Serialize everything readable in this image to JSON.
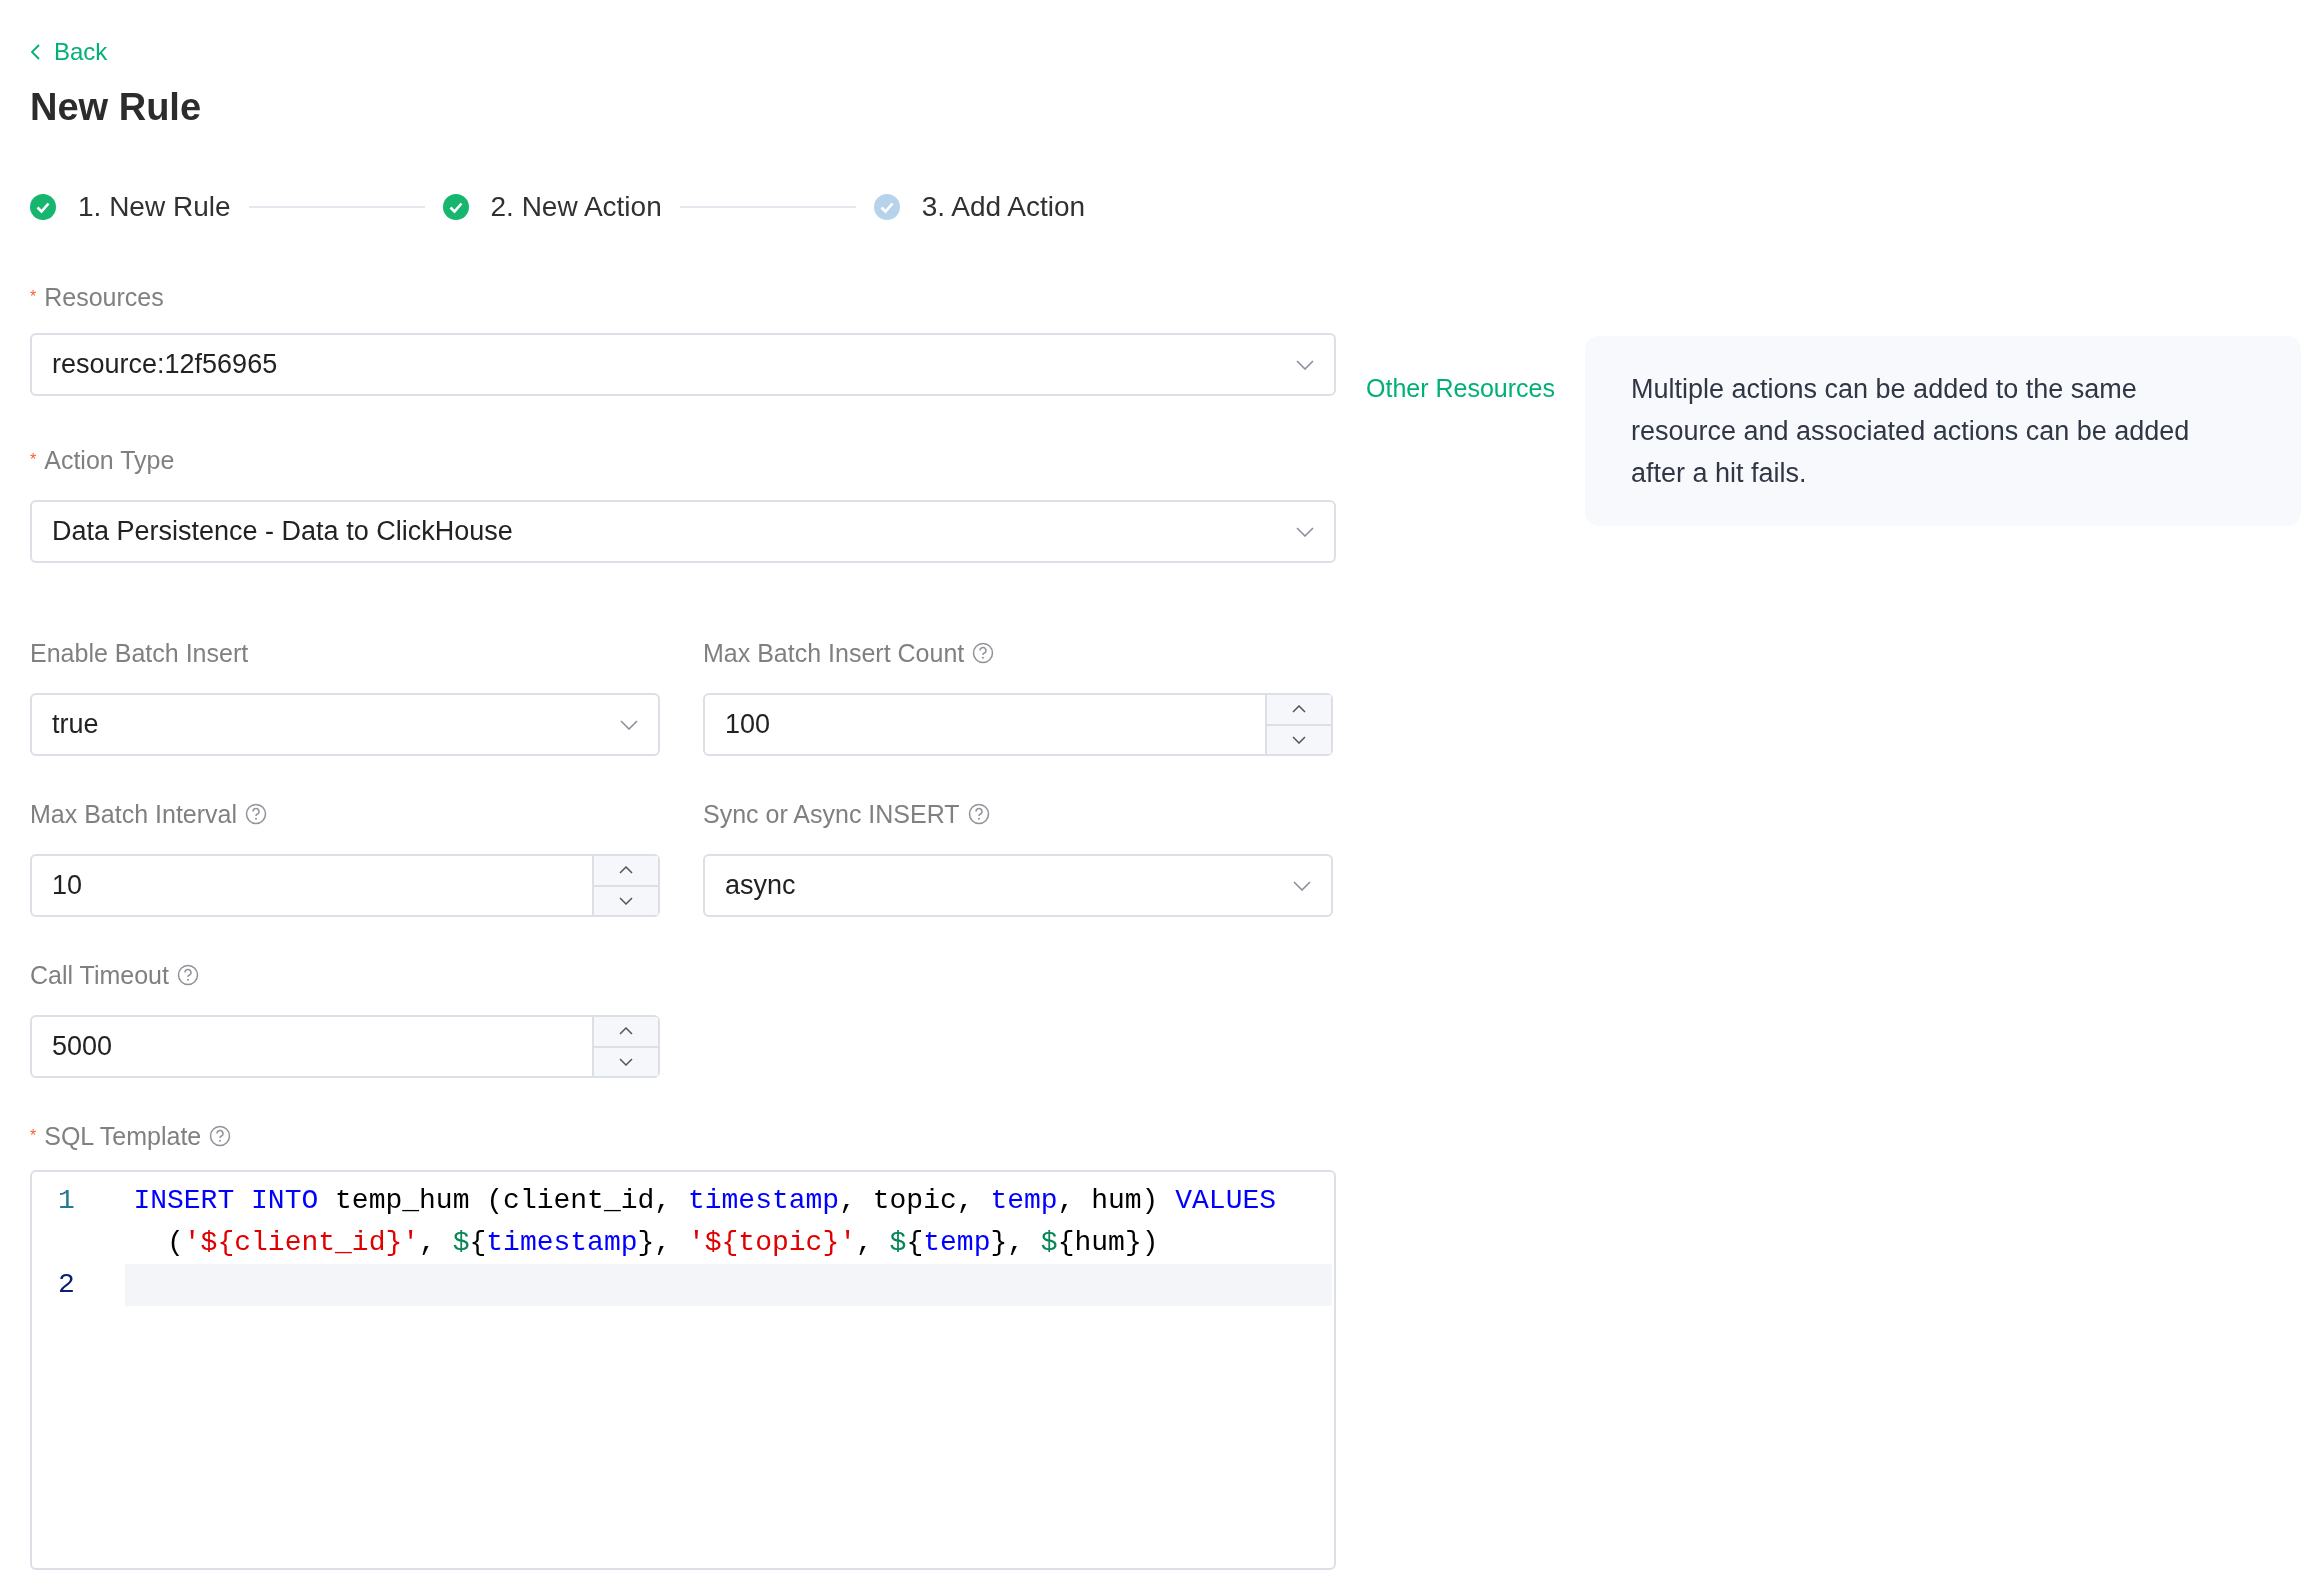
{
  "back": {
    "label": "Back"
  },
  "title": "New Rule",
  "steps": [
    {
      "label": "1. New Rule",
      "done": true
    },
    {
      "label": "2. New Action",
      "done": true
    },
    {
      "label": "3. Add Action",
      "done": false
    }
  ],
  "resources": {
    "label": "Resources",
    "required_mark": "*",
    "value": "resource:12f56965",
    "link": "Other Resources"
  },
  "action_type": {
    "label": "Action Type",
    "required_mark": "*",
    "value": "Data Persistence - Data to ClickHouse"
  },
  "tip": "Multiple actions can be added to the same resource and associated actions can be added after a hit fails.",
  "fields": [
    {
      "label": "Enable Batch Insert",
      "kind": "select",
      "value": "true"
    },
    {
      "label": "Max Batch Insert Count",
      "help": true,
      "kind": "number",
      "value": "100"
    },
    {
      "label": "Max Batch Interval",
      "help": true,
      "kind": "number",
      "value": "10"
    },
    {
      "label": "Sync or Async INSERT",
      "help": true,
      "kind": "select",
      "value": "async"
    },
    {
      "label": "Call Timeout",
      "help": true,
      "kind": "number",
      "value": "5000"
    }
  ],
  "sql": {
    "label": "SQL Template",
    "required_mark": "*",
    "help": true,
    "lines": [
      {
        "number": "1",
        "active": false,
        "tokens": [
          {
            "kind": "kw",
            "text": "INSERT INTO"
          },
          {
            "kind": "plain",
            "text": " temp_hum (client_id, "
          },
          {
            "kind": "kw",
            "text": "timestamp"
          },
          {
            "kind": "plain",
            "text": ", topic, "
          },
          {
            "kind": "kw",
            "text": "temp"
          },
          {
            "kind": "plain",
            "text": ", hum) "
          },
          {
            "kind": "kw",
            "text": "VALUES"
          },
          {
            "kind": "plain",
            "text": " ("
          },
          {
            "kind": "str",
            "text": "'${client_id}'"
          },
          {
            "kind": "plain",
            "text": ", "
          },
          {
            "kind": "var",
            "text": "$"
          },
          {
            "kind": "plain",
            "text": "{"
          },
          {
            "kind": "kw",
            "text": "timestamp"
          },
          {
            "kind": "plain",
            "text": "}, "
          },
          {
            "kind": "str",
            "text": "'${topic}'"
          },
          {
            "kind": "plain",
            "text": ", "
          },
          {
            "kind": "var",
            "text": "$"
          },
          {
            "kind": "plain",
            "text": "{"
          },
          {
            "kind": "kw",
            "text": "temp"
          },
          {
            "kind": "plain",
            "text": "}, "
          },
          {
            "kind": "var",
            "text": "$"
          },
          {
            "kind": "plain",
            "text": "{hum})"
          }
        ]
      },
      {
        "number": "2",
        "active": true
      }
    ]
  }
}
